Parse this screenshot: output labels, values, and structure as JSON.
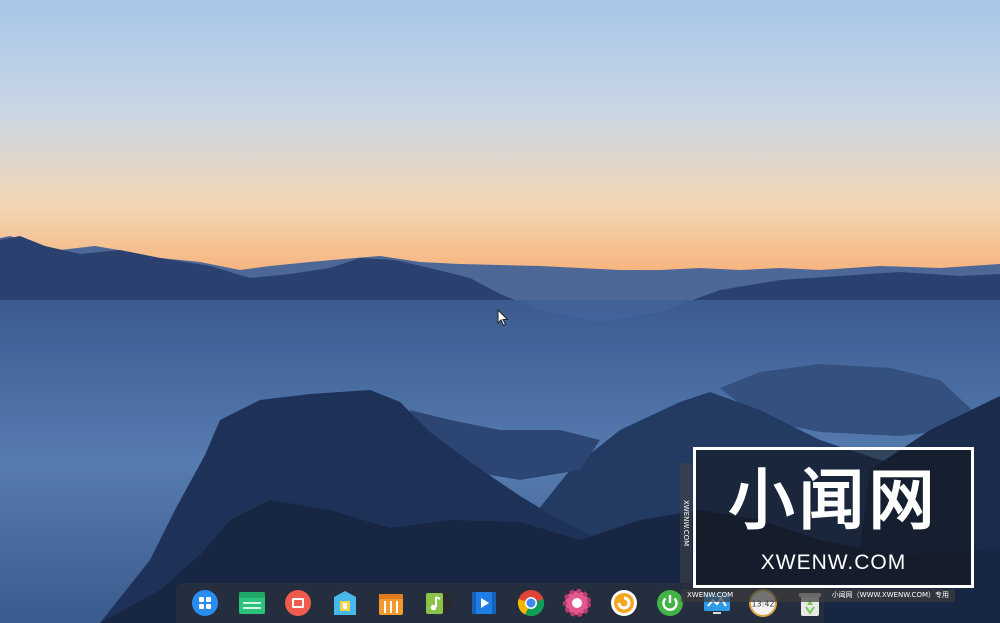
{
  "desktop": {
    "wallpaper_name": "misty mountains at dusk"
  },
  "dock": {
    "items": [
      {
        "name": "launcher-icon",
        "color": "#2a8cf0"
      },
      {
        "name": "file-manager-icon",
        "color": "#2bc37c"
      },
      {
        "name": "screenshot-icon",
        "color": "#ef5b4c"
      },
      {
        "name": "store-icon",
        "color": "#47b8ea"
      },
      {
        "name": "archive-manager-icon",
        "color": "#f39a2c"
      },
      {
        "name": "music-player-icon",
        "color": "#8bc34a"
      },
      {
        "name": "video-player-icon",
        "color": "#1e7de6"
      },
      {
        "name": "chrome-browser-icon",
        "color": "#4285f4"
      },
      {
        "name": "settings-icon",
        "color": "#e05a8f"
      },
      {
        "name": "crossover-icon",
        "color": "#f5a623"
      },
      {
        "name": "power-icon",
        "color": "#43b347"
      },
      {
        "name": "monitor-icon",
        "color": "#2d9be8"
      },
      {
        "name": "clock-icon",
        "color": "#f5f5f5"
      },
      {
        "name": "trash-icon",
        "color": "#78c850"
      }
    ],
    "clock_text": "13:42"
  },
  "watermark": {
    "title": "小闻网",
    "domain": "XWENW.COM",
    "side_text": "XWENW.COM",
    "strip_left": "XWENW.COM",
    "strip_right": "小闻网（WWW.XWENW.COM）专用"
  }
}
